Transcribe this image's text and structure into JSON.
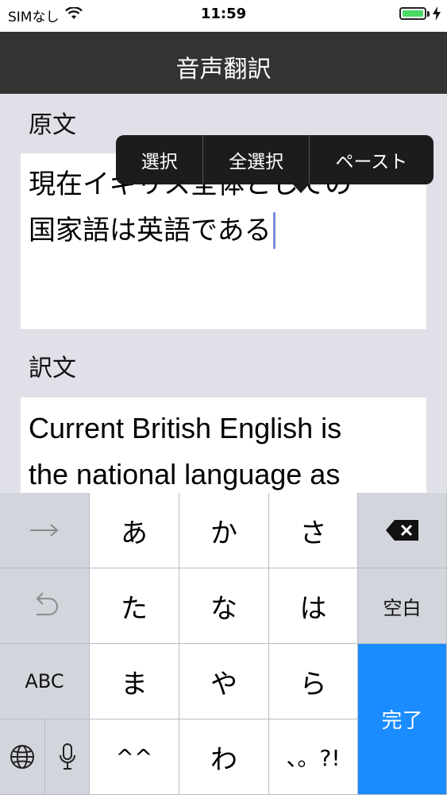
{
  "status_bar": {
    "carrier": "SIMなし",
    "time": "11:59",
    "battery_level": 1.0
  },
  "nav": {
    "title": "音声翻訳"
  },
  "source": {
    "label": "原文",
    "line1": "現在イギリス全体としての",
    "line2": "国家語は英語である"
  },
  "translation": {
    "label": "訳文",
    "line1": "Current British English is",
    "line2": "the national language as"
  },
  "edit_menu": {
    "select": "選択",
    "select_all": "全選択",
    "paste": "ペースト"
  },
  "keyboard": {
    "row1": {
      "k1": "あ",
      "k2": "か",
      "k3": "さ"
    },
    "row2": {
      "k1": "た",
      "k2": "な",
      "k3": "は",
      "space": "空白"
    },
    "row3": {
      "abc": "ABC",
      "k1": "ま",
      "k2": "や",
      "k3": "ら",
      "done": "完了"
    },
    "row4": {
      "k1": "^^",
      "k2": "わ",
      "k3": "、。?!"
    },
    "icons": {
      "next": "arrow-right-icon",
      "undo": "undo-icon",
      "delete": "delete-icon",
      "globe": "globe-icon",
      "mic": "mic-icon",
      "wifi": "wifi-icon"
    },
    "accent": "#1a8cff"
  }
}
